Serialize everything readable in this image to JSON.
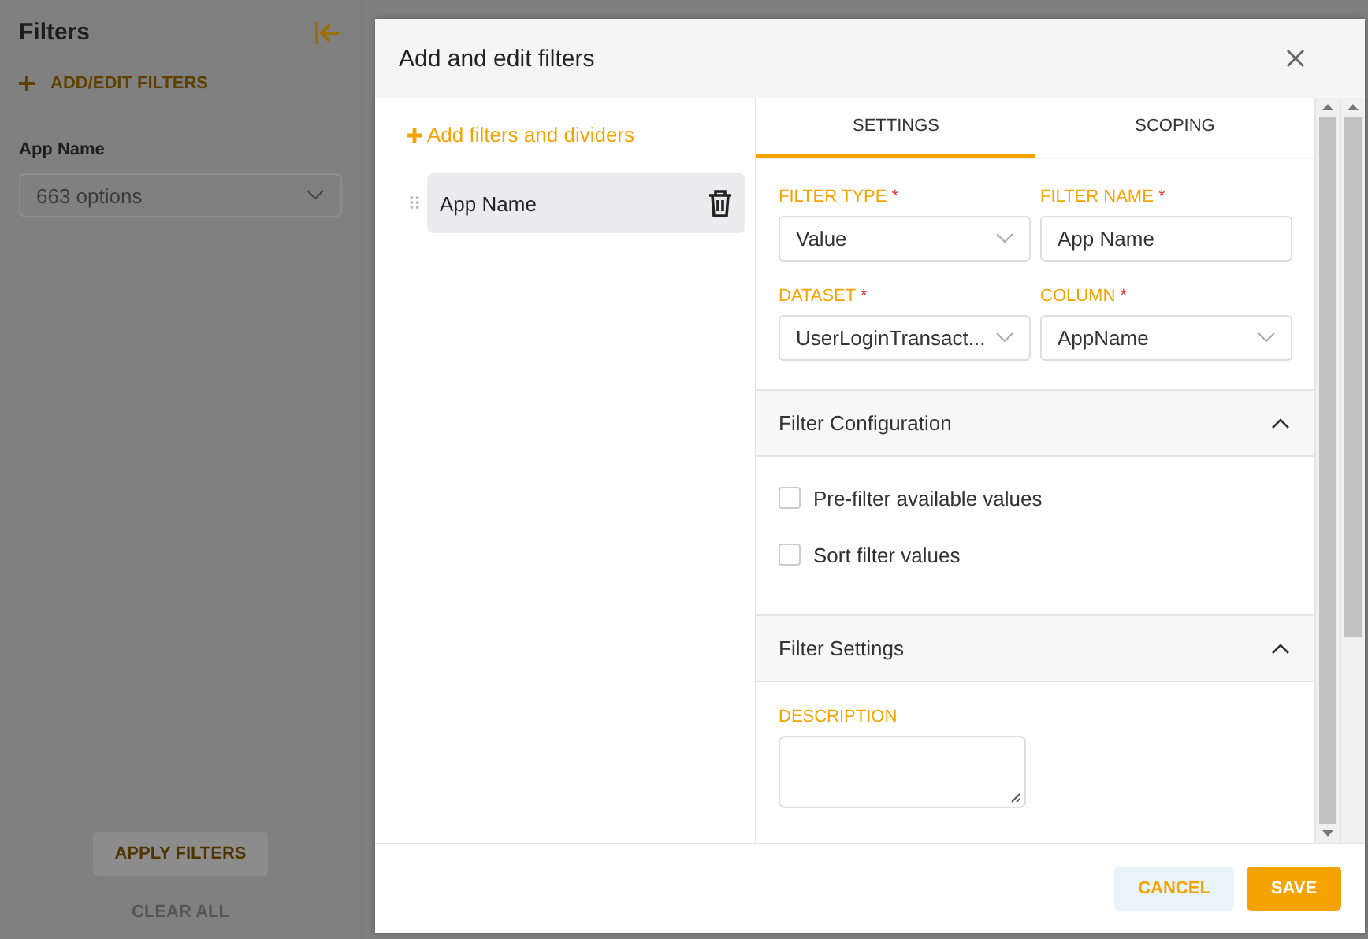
{
  "sidebar": {
    "title": "Filters",
    "add_button": "ADD/EDIT FILTERS",
    "filter_label": "App Name",
    "filter_placeholder": "663 options",
    "apply_button": "APPLY FILTERS",
    "clear_button": "CLEAR ALL"
  },
  "dialog": {
    "title": "Add and edit filters",
    "add_link": "Add filters and dividers",
    "filters": [
      {
        "label": "App Name",
        "selected": true
      }
    ],
    "tabs": [
      {
        "label": "SETTINGS",
        "selected": true
      },
      {
        "label": "SCOPING",
        "selected": false
      }
    ],
    "fields": [
      {
        "label": "FILTER TYPE",
        "required_mark": "*",
        "kind": "select",
        "value": "Value"
      },
      {
        "label": "FILTER NAME",
        "required_mark": "*",
        "kind": "text",
        "value": "App Name"
      },
      {
        "label": "DATASET",
        "required_mark": "*",
        "kind": "select",
        "value": "UserLoginTransact..."
      },
      {
        "label": "COLUMN",
        "required_mark": "*",
        "kind": "select",
        "value": "AppName"
      }
    ],
    "sections": [
      {
        "title": "Filter Configuration",
        "expanded": true,
        "options": [
          {
            "label": "Pre-filter available values",
            "checked": false
          },
          {
            "label": "Sort filter values",
            "checked": false
          }
        ]
      },
      {
        "title": "Filter Settings",
        "expanded": true,
        "description_label": "DESCRIPTION"
      }
    ],
    "buttons": [
      {
        "label": "CANCEL",
        "kind": "secondary"
      },
      {
        "label": "SAVE",
        "kind": "primary"
      }
    ]
  }
}
